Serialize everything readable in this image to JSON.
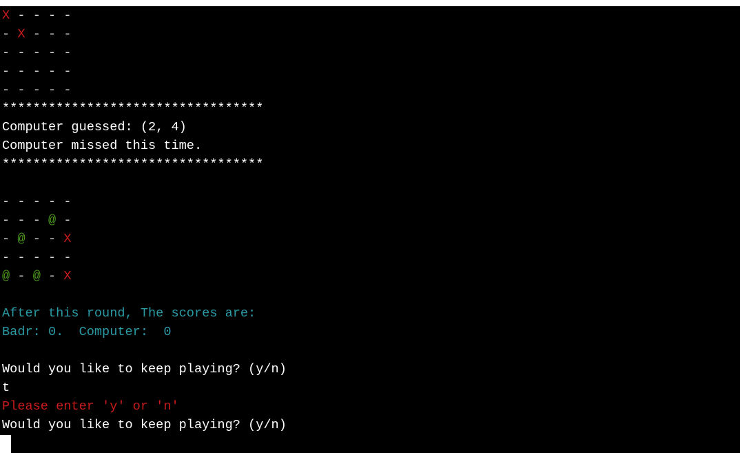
{
  "player_board": {
    "rows": [
      [
        "X",
        "-",
        "-",
        "-",
        "-"
      ],
      [
        "-",
        "X",
        "-",
        "-",
        "-"
      ],
      [
        "-",
        "-",
        "-",
        "-",
        "-"
      ],
      [
        "-",
        "-",
        "-",
        "-",
        "-"
      ],
      [
        "-",
        "-",
        "-",
        "-",
        "-"
      ]
    ]
  },
  "separator": "**********************************",
  "computer_guess": {
    "guess_line": "Computer guessed: (2, 4)",
    "result_line": "Computer missed this time."
  },
  "computer_board": {
    "rows": [
      [
        "-",
        "-",
        "-",
        "-",
        "-"
      ],
      [
        "-",
        "-",
        "-",
        "@",
        "-"
      ],
      [
        "-",
        "@",
        "-",
        "-",
        "X"
      ],
      [
        "-",
        "-",
        "-",
        "-",
        "-"
      ],
      [
        "@",
        "-",
        "@",
        "-",
        "X"
      ]
    ]
  },
  "scores": {
    "header": "After this round, The scores are:",
    "line": "Badr: 0.  Computer:  0"
  },
  "prompt": {
    "question_1": "Would you like to keep playing? (y/n)",
    "user_input": "t",
    "error": "Please enter 'y' or 'n'",
    "question_2": "Would you like to keep playing? (y/n)"
  },
  "colors": {
    "hit": "#c91b1b",
    "ship": "#4a9a1c",
    "empty": "#d7d7d7",
    "scores": "#2a9aa5",
    "error": "#c91b1b",
    "text": "#ffffff",
    "background": "#000000"
  }
}
